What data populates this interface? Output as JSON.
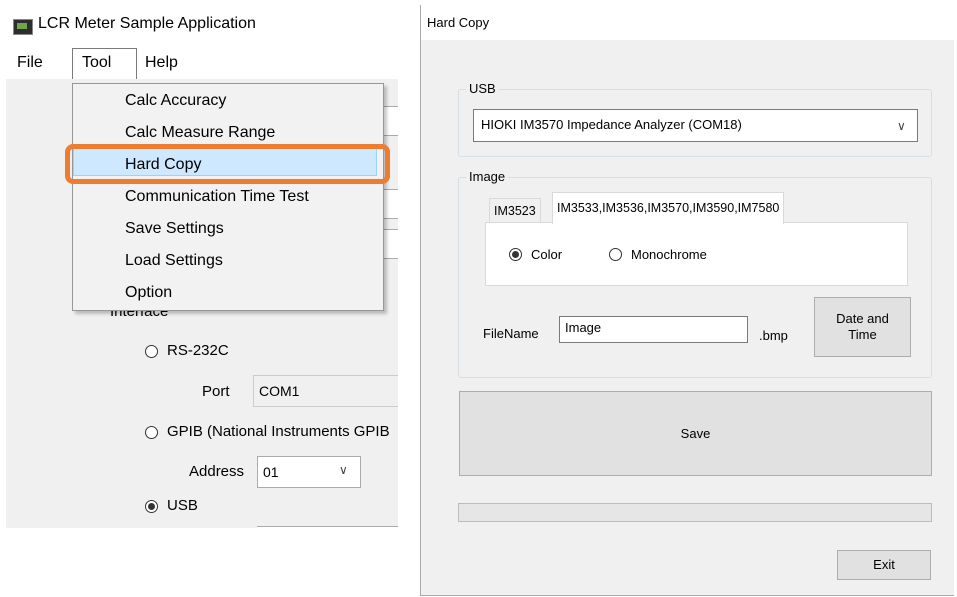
{
  "main_window": {
    "title": "LCR Meter Sample Application",
    "menu": [
      "File",
      "Tool",
      "Help"
    ],
    "tool_menu_items": [
      "Calc Accuracy",
      "Calc Measure Range",
      "Hard Copy",
      "Communication Time Test",
      "Save Settings",
      "Load Settings",
      "Option"
    ],
    "highlighted_item": "Hard Copy",
    "highlight_color": "#ed7d31",
    "interface_label": "Interface",
    "radio_rs232c": "RS-232C",
    "port_label": "Port",
    "port_value": "COM1",
    "radio_gpib": "GPIB (National Instruments GPIB",
    "address_label": "Address",
    "address_value": "01",
    "radio_usb": "USB",
    "selected_interface": "USB"
  },
  "hard_copy_dialog": {
    "title": "Hard Copy",
    "usb_group_label": "USB",
    "usb_device": "HIOKI IM3570 Impedance Analyzer (COM18)",
    "image_group_label": "Image",
    "tabs": [
      "IM3523",
      "IM3533,IM3536,IM3570,IM3590,IM7580"
    ],
    "active_tab": "IM3533,IM3536,IM3570,IM3590,IM7580",
    "color_option": "Color",
    "monochrome_option": "Monochrome",
    "selected_color_mode": "Color",
    "filename_label": "FileName",
    "filename_value": "Image",
    "extension": ".bmp",
    "date_time_button": "Date and Time",
    "save_button": "Save",
    "progress": 0,
    "exit_button": "Exit"
  }
}
